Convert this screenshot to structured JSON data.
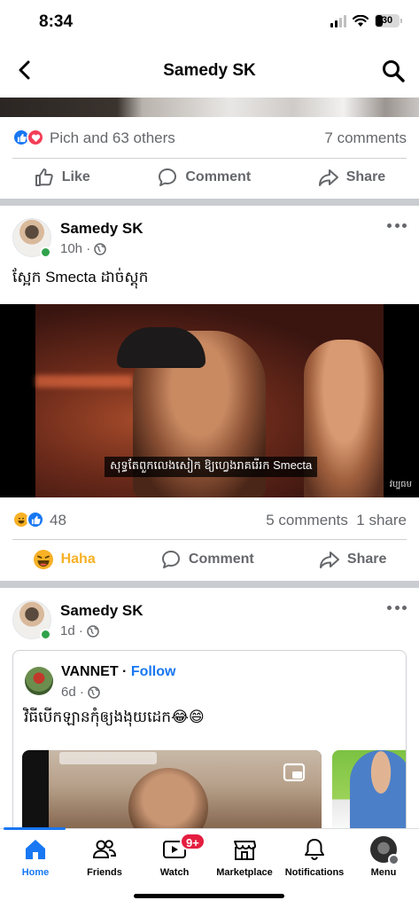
{
  "status": {
    "time": "8:34",
    "battery": "30"
  },
  "header": {
    "title": "Samedy SK"
  },
  "post1": {
    "reactions_text": "Pich and 63 others",
    "comments": "7 comments",
    "actions": {
      "like": "Like",
      "comment": "Comment",
      "share": "Share"
    }
  },
  "post2": {
    "author": "Samedy SK",
    "time": "10h ·",
    "text": "ស្អែក Smecta ដាច់ស្តុក",
    "video_subtitle": "សុទ្ធតែពួកលេងសៀក ឱ្យហ្វេងរាគរើរក Smecta",
    "watermark": "វប្បធម",
    "reaction_count": "48",
    "comments": "5 comments",
    "shares": "1 share",
    "actions": {
      "haha": "Haha",
      "comment": "Comment",
      "share": "Share"
    }
  },
  "post3": {
    "author": "Samedy SK",
    "time": "1d ·",
    "shared": {
      "author": "VANNET",
      "separator": " · ",
      "follow": "Follow",
      "time": "6d ·",
      "text": "វិធីបើកឡានកុំឲ្យងងុយដេក😂😄"
    }
  },
  "bottom_nav": {
    "items": [
      {
        "label": "Home",
        "icon": "home-icon",
        "active": true
      },
      {
        "label": "Friends",
        "icon": "friends-icon"
      },
      {
        "label": "Watch",
        "icon": "watch-icon",
        "badge": "9+"
      },
      {
        "label": "Marketplace",
        "icon": "marketplace-icon"
      },
      {
        "label": "Notifications",
        "icon": "bell-icon"
      },
      {
        "label": "Menu",
        "icon": "avatar"
      }
    ]
  },
  "colors": {
    "brand": "#1877f2",
    "haha": "#f7b125",
    "badge": "#e41e3f",
    "online": "#31a24c"
  }
}
